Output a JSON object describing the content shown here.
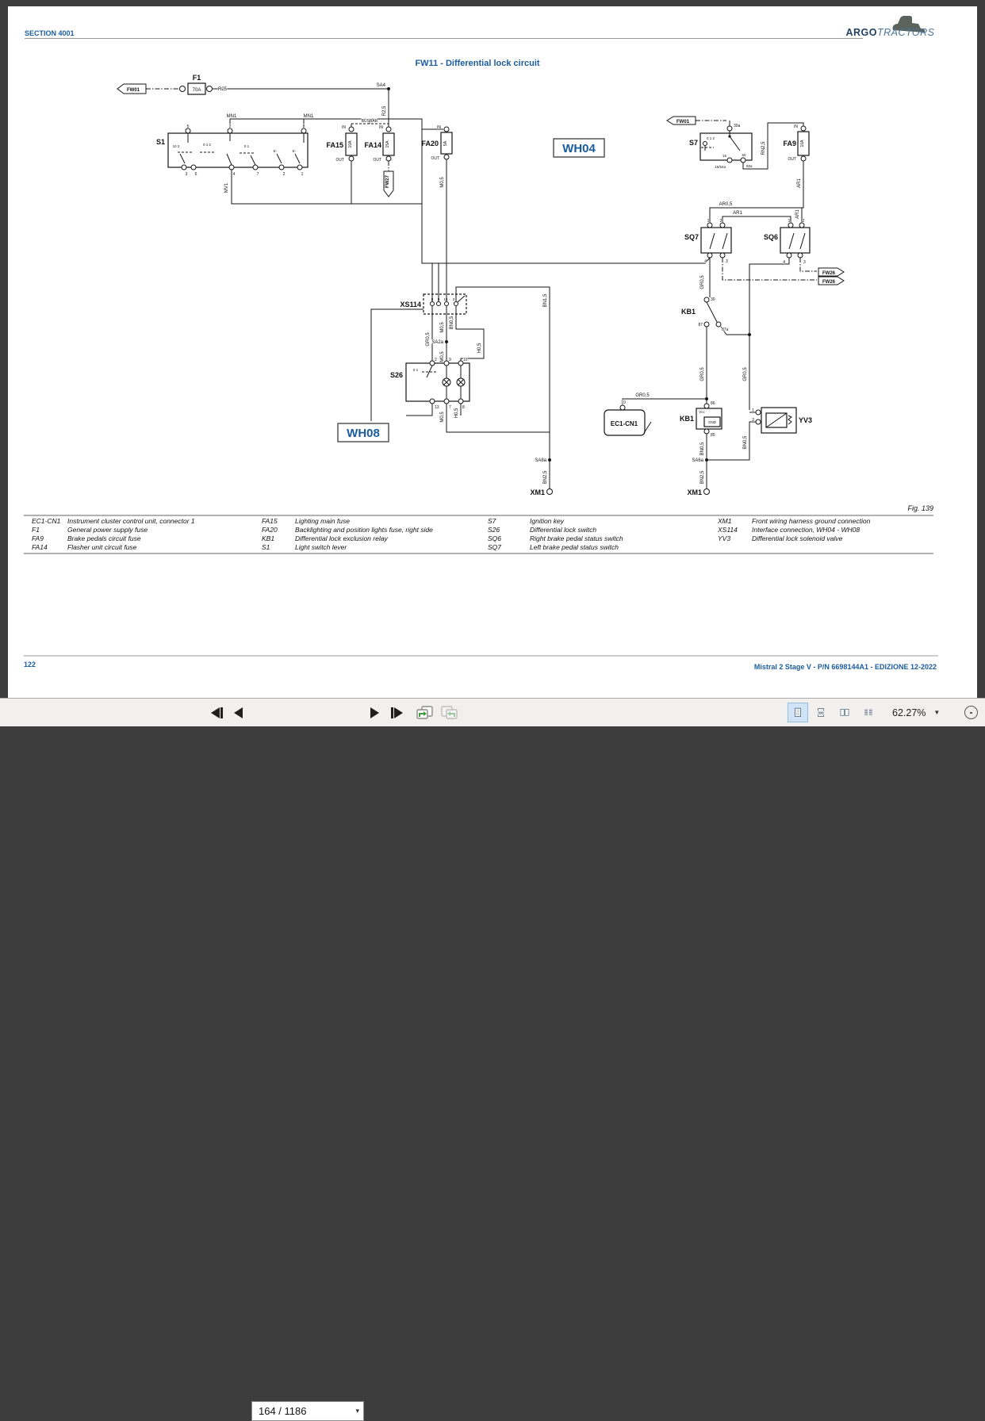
{
  "header": {
    "section_label": "SECTION 4001",
    "logo_text_bold": "ARGO",
    "logo_text_italic": "TRACTORS"
  },
  "document": {
    "title": "FW11 - Differential lock circuit",
    "fig_label": "Fig. 139",
    "page_number": "122",
    "footer_text": "Mistral 2 Stage V - P/N 6698144A1 - EDIZIONE 12-2022",
    "harness_wh04": "WH04",
    "harness_wh08": "WH08"
  },
  "legend": {
    "columns": [
      [
        [
          "EC1-CN1",
          "Instrument cluster control unit, connector 1"
        ],
        [
          "F1",
          "General power supply fuse"
        ],
        [
          "FA9",
          "Brake pedals circuit fuse"
        ],
        [
          "FA14",
          "Flasher unit circuit fuse"
        ]
      ],
      [
        [
          "FA15",
          "Lighting main fuse"
        ],
        [
          "FA20",
          "Backlighting and position lights fuse, right side"
        ],
        [
          "KB1",
          "Differential lock exclusion relay"
        ],
        [
          "S1",
          "Light switch lever"
        ]
      ],
      [
        [
          "S7",
          "Ignition key"
        ],
        [
          "S26",
          "Differential lock switch"
        ],
        [
          "SQ6",
          "Right brake pedal status switch"
        ],
        [
          "SQ7",
          "Left brake pedal status switch"
        ]
      ],
      [
        [
          "XM1",
          "Front wiring harness ground connection"
        ],
        [
          "XS114",
          "Interface connection, WH04 - WH08"
        ],
        [
          "YV3",
          "Differential lock solenoid valve"
        ]
      ]
    ]
  },
  "toolbar": {
    "page_field": "164 / 1186",
    "zoom_level": "62.27%",
    "icons": [
      "first-page",
      "previous-page",
      "next-page",
      "last-page",
      "previous-view",
      "next-view",
      "single-page-view",
      "enable-scrolling",
      "two-page-view",
      "two-page-scrolling",
      "page-dropdown-caret",
      "zoom-dropdown-caret",
      "zoom-out"
    ]
  },
  "colors": {
    "accent": "#1a5c9c",
    "frame": "#3d3d3d",
    "toolbar-bg": "#f1f0ef",
    "icon-active-bg": "#cfe4f7"
  },
  "diagram": {
    "labels": [
      [
        "S1",
        208,
        182,
        "c",
        "e",
        0
      ],
      [
        "F1",
        248,
        101,
        "c",
        "m",
        0
      ],
      [
        "FA15",
        433,
        186,
        "c",
        "e",
        0
      ],
      [
        "FA14",
        481,
        186,
        "c",
        "e",
        0
      ],
      [
        "FA20",
        553,
        184,
        "c",
        "e",
        0
      ],
      [
        "FA9",
        1004,
        184,
        "c",
        "e",
        0
      ],
      [
        "S7",
        880,
        183,
        "c",
        "e",
        0
      ],
      [
        "SQ7",
        881,
        302,
        "c",
        "e",
        0
      ],
      [
        "SQ6",
        981,
        302,
        "c",
        "e",
        0
      ],
      [
        "KB1",
        877,
        396,
        "c",
        "e",
        0
      ],
      [
        "KB1",
        875,
        531,
        "c",
        "e",
        0
      ],
      [
        "S26",
        508,
        476,
        "c",
        "e",
        0
      ],
      [
        "XS114",
        531,
        387,
        "c",
        "e",
        0
      ],
      [
        "EC1-CN1",
        787,
        537,
        "c8",
        "m",
        0
      ],
      [
        "YV3",
        1007,
        533,
        "c",
        "s",
        0
      ],
      [
        "XM1",
        687,
        624,
        "c",
        "e",
        0
      ],
      [
        "XM1",
        885,
        624,
        "c",
        "e",
        0
      ],
      [
        "70A",
        248,
        115,
        "w",
        "m",
        0
      ],
      [
        "R25",
        275,
        114,
        "w",
        "s",
        0
      ],
      [
        "SA4",
        486,
        109,
        "w",
        "e",
        0
      ],
      [
        "R2,5",
        486,
        140,
        "w",
        "m",
        1
      ],
      [
        "MN1",
        292,
        148,
        "w",
        "m",
        0
      ],
      [
        "MN1",
        389,
        148,
        "w",
        "m",
        0
      ],
      [
        "BUSBAR",
        466,
        154,
        "t",
        "m",
        0
      ],
      [
        "MV1",
        287,
        237,
        "w",
        "m",
        1
      ],
      [
        "IN",
        436,
        162,
        "t",
        "e",
        0
      ],
      [
        "IN",
        483,
        162,
        "t",
        "e",
        0
      ],
      [
        "OUT",
        434,
        203,
        "t",
        "e",
        0
      ],
      [
        "OUT",
        481,
        203,
        "t",
        "e",
        0
      ],
      [
        "10A",
        443,
        182,
        "t",
        "m",
        1
      ],
      [
        "15A",
        490,
        182,
        "t",
        "m",
        1
      ],
      [
        "IN",
        556,
        162,
        "t",
        "e",
        0
      ],
      [
        "OUT",
        554,
        201,
        "t",
        "e",
        0
      ],
      [
        "5A",
        563,
        181,
        "t",
        "m",
        1
      ],
      [
        "IN",
        1006,
        161,
        "t",
        "e",
        0
      ],
      [
        "OUT",
        1004,
        202,
        "t",
        "e",
        0
      ],
      [
        "10A",
        1013,
        181,
        "t",
        "m",
        1
      ],
      [
        "M0,5",
        559,
        230,
        "w",
        "m",
        1
      ],
      [
        "30a",
        925,
        160,
        "t",
        "s",
        0
      ],
      [
        "0 1 2",
        896,
        176,
        "t4",
        "m",
        0
      ],
      [
        "15",
        916,
        198,
        "t4",
        "e",
        0
      ],
      [
        "50",
        938,
        197,
        "t4",
        "m",
        0
      ],
      [
        "15/54a",
        915,
        212,
        "t4",
        "e",
        0
      ],
      [
        "50a",
        941,
        211,
        "t4",
        "s",
        0
      ],
      [
        "RN2,5",
        964,
        187,
        "w",
        "m",
        1
      ],
      [
        "AR1",
        1009,
        231,
        "w",
        "m",
        1
      ],
      [
        "AR0,5",
        915,
        259,
        "w",
        "m",
        0
      ],
      [
        "AR1",
        930,
        270,
        "w",
        "m",
        0
      ],
      [
        "AR1",
        1007,
        270,
        "w",
        "m",
        1
      ],
      [
        "1",
        893,
        280,
        "t",
        "m",
        0
      ],
      [
        "2",
        909,
        280,
        "t",
        "m",
        0
      ],
      [
        "4",
        891,
        331,
        "t",
        "e",
        0
      ],
      [
        "3",
        915,
        331,
        "t",
        "s",
        0
      ],
      [
        "1",
        995,
        280,
        "t",
        "m",
        0
      ],
      [
        "2",
        1013,
        280,
        "t",
        "m",
        0
      ],
      [
        "4",
        990,
        332,
        "t",
        "e",
        0
      ],
      [
        "3",
        1013,
        332,
        "t",
        "s",
        0
      ],
      [
        "GR0,5",
        887,
        356,
        "w",
        "m",
        1
      ],
      [
        "30",
        896,
        379,
        "t",
        "s",
        0
      ],
      [
        "87",
        886,
        411,
        "t",
        "e",
        0
      ],
      [
        "87a",
        910,
        417,
        "t",
        "s",
        0
      ],
      [
        "8",
        545,
        379,
        "t4",
        "m",
        0
      ],
      [
        "9",
        553,
        379,
        "t4",
        "m",
        0
      ],
      [
        "14",
        562,
        379,
        "t4",
        "m",
        0
      ],
      [
        "2",
        572,
        379,
        "t4",
        "m",
        0
      ],
      [
        "GR0,5",
        541,
        428,
        "w",
        "m",
        1
      ],
      [
        "M0,5",
        559,
        413,
        "w",
        "m",
        1
      ],
      [
        "SA2a",
        559,
        433,
        "w",
        "e",
        0
      ],
      [
        "M0,5",
        559,
        450,
        "w",
        "m",
        1
      ],
      [
        "BN0,5",
        571,
        407,
        "w",
        "m",
        1
      ],
      [
        "H0,5",
        606,
        439,
        "w",
        "m",
        1
      ],
      [
        "BN1,5",
        689,
        379,
        "w",
        "m",
        1
      ],
      [
        "2",
        548,
        455,
        "t",
        "s",
        0
      ],
      [
        "9",
        566,
        455,
        "t",
        "s",
        0
      ],
      [
        "10",
        584,
        455,
        "t",
        "s",
        0
      ],
      [
        "13",
        548,
        515,
        "t",
        "s",
        0
      ],
      [
        "7",
        566,
        515,
        "t",
        "s",
        0
      ],
      [
        "8",
        583,
        515,
        "t",
        "s",
        0
      ],
      [
        "0 1",
        524,
        468,
        "t4",
        "m",
        0
      ],
      [
        "M0,5",
        559,
        526,
        "w",
        "m",
        1
      ],
      [
        "H0,5",
        577,
        521,
        "w",
        "m",
        1
      ],
      [
        "GR0,5",
        810,
        500,
        "w",
        "m",
        0
      ],
      [
        "GR0,5",
        887,
        472,
        "w",
        "m",
        1
      ],
      [
        "GR0,5",
        941,
        472,
        "w",
        "m",
        1
      ],
      [
        "BN0,5",
        887,
        566,
        "w",
        "m",
        1
      ],
      [
        "BN0,5",
        941,
        558,
        "w",
        "m",
        1
      ],
      [
        "10",
        786,
        509,
        "t",
        "m",
        0
      ],
      [
        "86",
        896,
        510,
        "t",
        "s",
        0
      ],
      [
        "85",
        896,
        550,
        "t",
        "s",
        0
      ],
      [
        "Vcc",
        885,
        521,
        "t4",
        "m",
        0
      ],
      [
        "GND",
        898,
        534,
        "t4",
        "m",
        0
      ],
      [
        "1",
        951,
        519,
        "t",
        "e",
        0
      ],
      [
        "2",
        951,
        531,
        "t",
        "e",
        0
      ],
      [
        "SA8a",
        689,
        582,
        "w",
        "e",
        0
      ],
      [
        "SA6a",
        887,
        582,
        "w",
        "e",
        0
      ],
      [
        "BN2,5",
        689,
        602,
        "w",
        "m",
        1
      ],
      [
        "BN2,5",
        887,
        602,
        "w",
        "m",
        1
      ],
      [
        "5",
        237,
        161,
        "t",
        "m",
        0
      ],
      [
        "2",
        290,
        161,
        "t",
        "m",
        0
      ],
      [
        "8",
        383,
        161,
        "t",
        "m",
        0
      ],
      [
        "3",
        235,
        221,
        "t",
        "m",
        0
      ],
      [
        "6",
        247,
        221,
        "t",
        "m",
        0
      ],
      [
        "4",
        295,
        221,
        "t",
        "m",
        0
      ],
      [
        "7",
        325,
        221,
        "t",
        "m",
        0
      ],
      [
        "2",
        358,
        221,
        "t",
        "m",
        0
      ],
      [
        "1",
        381,
        221,
        "t",
        "m",
        0
      ],
      [
        "10 2",
        222,
        186,
        "t4",
        "m",
        0
      ],
      [
        "0 1 2",
        261,
        184,
        "t4",
        "m",
        0
      ],
      [
        "0 1",
        311,
        186,
        "t4",
        "m",
        0
      ],
      [
        "E-",
        347,
        192,
        "t4",
        "m",
        0
      ],
      [
        "E-",
        371,
        192,
        "t4",
        "m",
        0
      ],
      [
        "FW01",
        168,
        115,
        "a",
        "m",
        0
      ],
      [
        "FW01",
        861,
        155,
        "a",
        "m",
        0
      ],
      [
        "FW27",
        490,
        229,
        "a",
        "m",
        1
      ],
      [
        "FW26",
        1045,
        346,
        "a",
        "m",
        0
      ],
      [
        "FW26",
        1045,
        357,
        "a",
        "m",
        0
      ]
    ]
  }
}
